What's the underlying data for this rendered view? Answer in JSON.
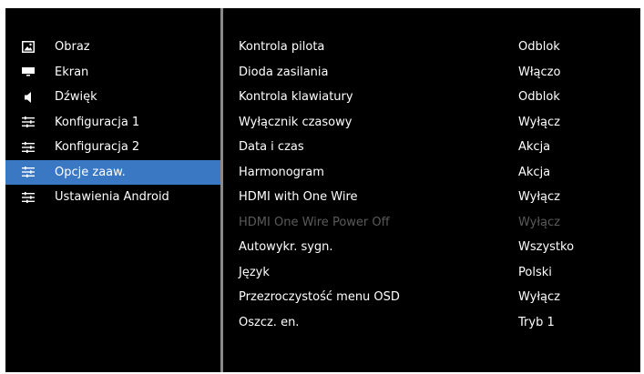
{
  "categories": [
    {
      "label": "Obraz",
      "icon": "image-icon",
      "selected": false
    },
    {
      "label": "Ekran",
      "icon": "screen-icon",
      "selected": false
    },
    {
      "label": "Dźwięk",
      "icon": "speaker-icon",
      "selected": false
    },
    {
      "label": "Konfiguracja 1",
      "icon": "sliders-icon",
      "selected": false
    },
    {
      "label": "Konfiguracja 2",
      "icon": "sliders-icon",
      "selected": false
    },
    {
      "label": "Opcje zaaw.",
      "icon": "sliders-icon",
      "selected": true
    },
    {
      "label": "Ustawienia Android",
      "icon": "sliders-icon",
      "selected": false
    }
  ],
  "settings": [
    {
      "label": "Kontrola pilota",
      "value": "Odblok",
      "disabled": false
    },
    {
      "label": "Dioda zasilania",
      "value": "Włączo",
      "disabled": false
    },
    {
      "label": "Kontrola klawiatury",
      "value": "Odblok",
      "disabled": false
    },
    {
      "label": "Wyłącznik czasowy",
      "value": "Wyłącz",
      "disabled": false
    },
    {
      "label": "Data i czas",
      "value": "Akcja",
      "disabled": false
    },
    {
      "label": "Harmonogram",
      "value": "Akcja",
      "disabled": false
    },
    {
      "label": "HDMI with One Wire",
      "value": "Wyłącz",
      "disabled": false
    },
    {
      "label": "HDMI One Wire Power Off",
      "value": "Wyłącz",
      "disabled": true
    },
    {
      "label": "Autowykr. sygn.",
      "value": "Wszystko",
      "disabled": false
    },
    {
      "label": "Język",
      "value": "Polski",
      "disabled": false
    },
    {
      "label": "Przezroczystość menu OSD",
      "value": "Wyłącz",
      "disabled": false
    },
    {
      "label": "Oszcz. en.",
      "value": "Tryb 1",
      "disabled": false
    }
  ],
  "colors": {
    "background": "#000000",
    "selected": "#3a78c4",
    "divider": "#8a8a8a",
    "text": "#ffffff",
    "disabled_text": "#5a5a5a"
  }
}
